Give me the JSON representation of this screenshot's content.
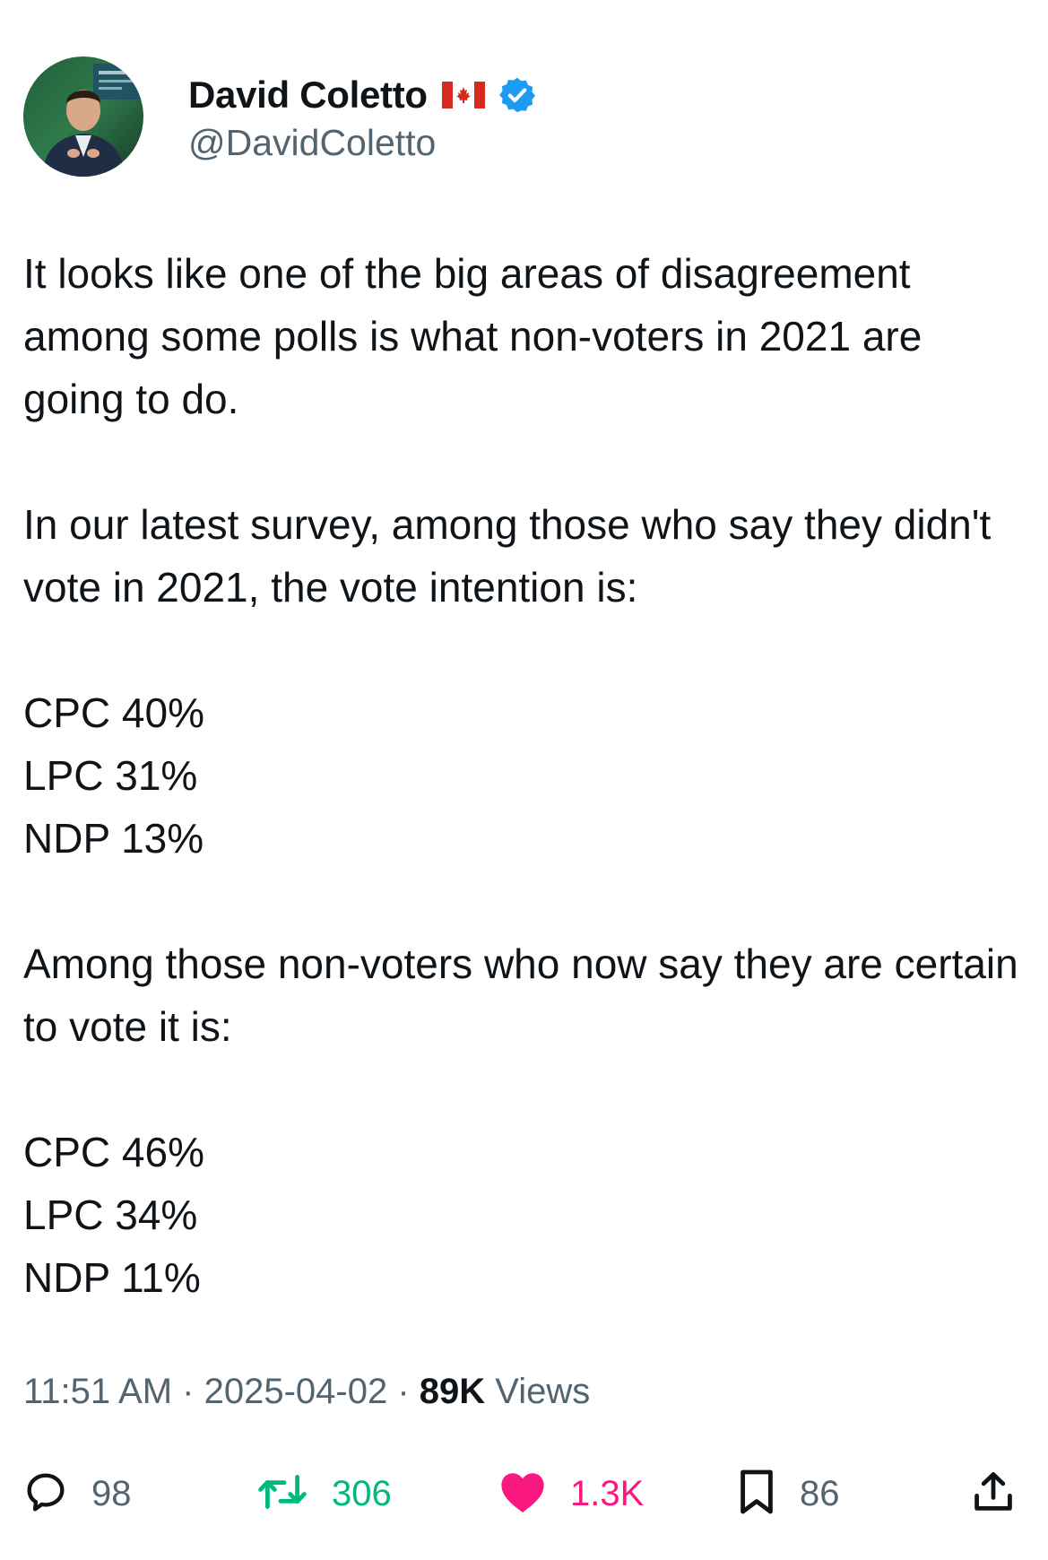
{
  "author": {
    "display_name": "David Coletto",
    "flag_icon": "canada-flag-icon",
    "verified_icon": "verified-badge-icon",
    "verified_color": "#1d9bf0",
    "handle": "@DavidColetto"
  },
  "body": {
    "para1": "It looks like one of the big areas of disagreement among some polls is what non-voters in 2021 are going to do.",
    "para2": "In our latest survey, among those who say they didn't vote in 2021, the vote intention is:",
    "list1": [
      "CPC 40%",
      "LPC 31%",
      "NDP 13%"
    ],
    "para3": "Among those non-voters who now say they are certain to vote it is:",
    "list2": [
      "CPC 46%",
      "LPC 34%",
      "NDP 11%"
    ]
  },
  "meta": {
    "time": "11:51 AM",
    "sep1": " · ",
    "date": "2025-04-02",
    "sep2": " · ",
    "views_count": "89K",
    "views_label": " Views"
  },
  "actions": {
    "reply": {
      "icon": "reply-icon",
      "count": "98"
    },
    "retweet": {
      "icon": "retweet-icon",
      "count": "306",
      "color": "#00ba7c"
    },
    "like": {
      "icon": "heart-icon",
      "count": "1.3K",
      "color": "#f91880"
    },
    "bookmark": {
      "icon": "bookmark-icon",
      "count": "86"
    },
    "share": {
      "icon": "share-icon"
    }
  },
  "colors": {
    "text": "#0f1419",
    "secondary": "#536471"
  }
}
